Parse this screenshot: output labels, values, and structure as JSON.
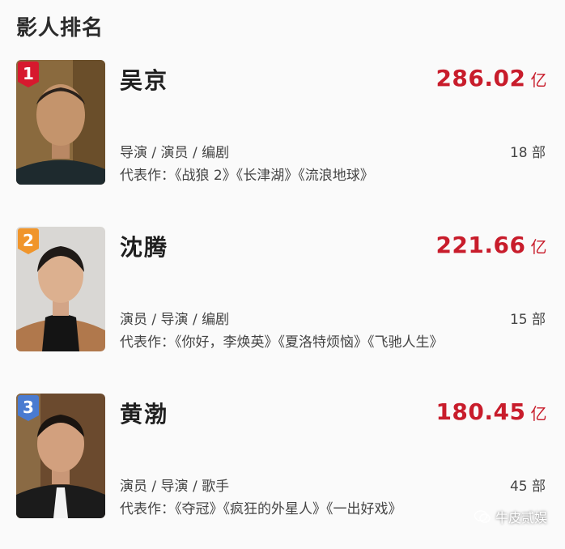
{
  "page": {
    "title": "影人排名"
  },
  "ranking": [
    {
      "rank": "1",
      "rank_color": "#d7192e",
      "name": "吴京",
      "box_value": "286.02",
      "box_unit": "亿",
      "roles": "导演 / 演员 / 编剧",
      "film_count": "18 部",
      "works": "代表作：《战狼 2》《长津湖》《流浪地球》"
    },
    {
      "rank": "2",
      "rank_color": "#f0952b",
      "name": "沈腾",
      "box_value": "221.66",
      "box_unit": "亿",
      "roles": "演员 / 导演 / 编剧",
      "film_count": "15 部",
      "works": "代表作：《你好，李焕英》《夏洛特烦恼》《飞驰人生》"
    },
    {
      "rank": "3",
      "rank_color": "#4a7bd0",
      "name": "黄渤",
      "box_value": "180.45",
      "box_unit": "亿",
      "roles": "演员 / 导演 / 歌手",
      "film_count": "45 部",
      "works": "代表作：《夺冠》《疯狂的外星人》《一出好戏》"
    }
  ],
  "watermark": {
    "text": "牛皮贰娱",
    "icon": "wechat-icon"
  }
}
